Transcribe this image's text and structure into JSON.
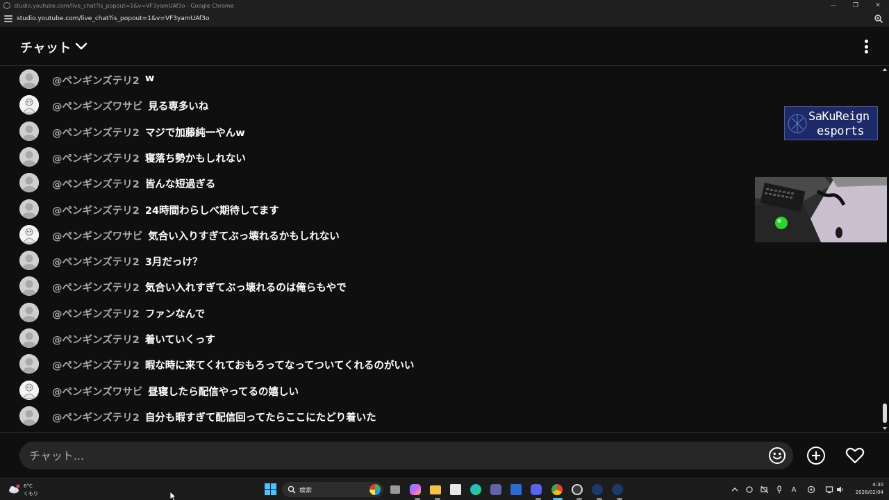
{
  "browser": {
    "window_title": "studio.youtube.com/live_chat?is_popout=1&v=VF3yamUAf3o - Google Chrome",
    "url": "studio.youtube.com/live_chat?is_popout=1&v=VF3yamUAf3o",
    "controls": [
      "—",
      "❐",
      "✕"
    ]
  },
  "chat": {
    "title": "チャット",
    "input_placeholder": "チャット...",
    "messages": [
      {
        "author": "@ペンギンズテリ2",
        "text": "w",
        "avatar": "gray"
      },
      {
        "author": "@ペンギンズワサビ",
        "text": "見る専多いね",
        "avatar": "white"
      },
      {
        "author": "@ペンギンズテリ2",
        "text": "マジで加藤純一やんw",
        "avatar": "gray"
      },
      {
        "author": "@ペンギンズテリ2",
        "text": "寝落ち勢かもしれない",
        "avatar": "gray"
      },
      {
        "author": "@ペンギンズテリ2",
        "text": "皆んな短過ぎる",
        "avatar": "gray"
      },
      {
        "author": "@ペンギンズテリ2",
        "text": "24時間わらしべ期待してます",
        "avatar": "gray"
      },
      {
        "author": "@ペンギンズワサビ",
        "text": "気合い入りすぎてぶっ壊れるかもしれない",
        "avatar": "white"
      },
      {
        "author": "@ペンギンズテリ2",
        "text": "3月だっけ？",
        "avatar": "gray"
      },
      {
        "author": "@ペンギンズテリ2",
        "text": "気合い入れすぎてぶっ壊れるのは俺らもやで",
        "avatar": "gray"
      },
      {
        "author": "@ペンギンズテリ2",
        "text": "ファンなんで",
        "avatar": "gray"
      },
      {
        "author": "@ペンギンズテリ2",
        "text": "着いていくっす",
        "avatar": "gray"
      },
      {
        "author": "@ペンギンズテリ2",
        "text": "暇な時に来てくれておもろってなってついてくれるのがいい",
        "avatar": "gray"
      },
      {
        "author": "@ペンギンズワサビ",
        "text": "昼寝したら配信やってるの嬉しい",
        "avatar": "white"
      },
      {
        "author": "@ペンギンズテリ2",
        "text": "自分も暇すぎて配信回ってたらここにたどり着いた",
        "avatar": "gray"
      }
    ]
  },
  "overlay": {
    "logo_line1": "SaKuReign",
    "logo_line2": "esports"
  },
  "taskbar": {
    "weather_temp": "6°C",
    "weather_cond": "くもり",
    "search_label": "検索",
    "time": "4:30",
    "date": "2026/02/04",
    "tray_ime": "A"
  },
  "colors": {
    "background": "#0f0f0f",
    "author": "#aaaaaa",
    "message": "#ffffff",
    "input_bg": "#272727",
    "accent": "#4cc2ff"
  }
}
